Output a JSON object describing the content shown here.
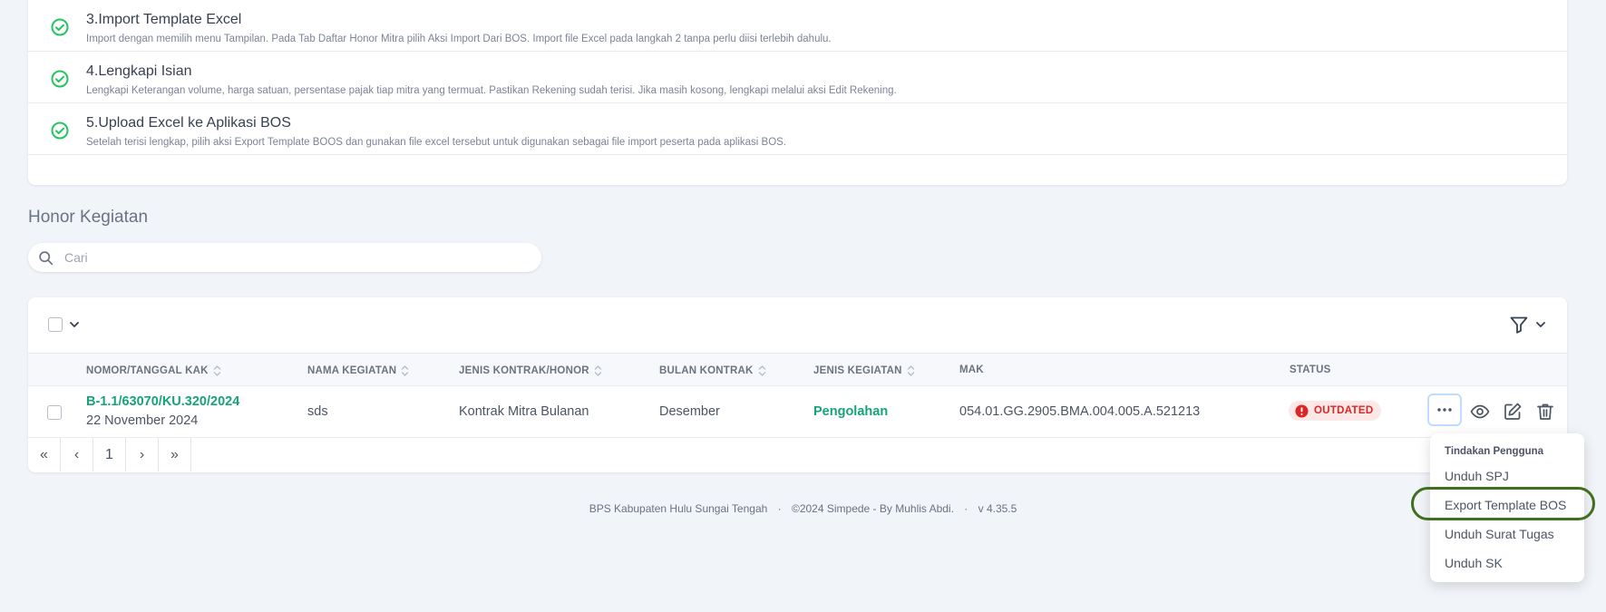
{
  "steps": [
    {
      "title": "3.Import Template Excel",
      "desc": "Import dengan memilih menu Tampilan. Pada Tab Daftar Honor Mitra pilih Aksi Import Dari BOS. Import file Excel pada langkah 2 tanpa perlu diisi terlebih dahulu."
    },
    {
      "title": "4.Lengkapi Isian",
      "desc": "Lengkapi Keterangan volume, harga satuan, persentase pajak tiap mitra yang termuat. Pastikan Rekening sudah terisi. Jika masih kosong, lengkapi melalui aksi Edit Rekening."
    },
    {
      "title": "5.Upload Excel ke Aplikasi BOS",
      "desc": "Setelah terisi lengkap, pilih aksi Export Template BOOS dan gunakan file excel tersebut untuk digunakan sebagai file import peserta pada aplikasi BOS."
    }
  ],
  "section_title": "Honor Kegiatan",
  "search": {
    "placeholder": "Cari",
    "value": ""
  },
  "table": {
    "columns": [
      "NOMOR/TANGGAL KAK",
      "NAMA KEGIATAN",
      "JENIS KONTRAK/HONOR",
      "BULAN KONTRAK",
      "JENIS KEGIATAN",
      "MAK",
      "STATUS"
    ],
    "rows": [
      {
        "nomor": "B-1.1/63070/KU.320/2024",
        "tanggal": "22 November 2024",
        "nama": "sds",
        "jenis_kontrak": "Kontrak Mitra Bulanan",
        "bulan": "Desember",
        "jenis_kegiatan": "Pengolahan",
        "mak": "054.01.GG.2905.BMA.004.005.A.521213",
        "status": "OUTDATED"
      }
    ]
  },
  "pagination": {
    "first": "«",
    "prev": "‹",
    "current": "1",
    "next": "›",
    "last": "»"
  },
  "footer": {
    "org": "BPS Kabupaten Hulu Sungai Tengah",
    "sep": "·",
    "copy": "©2024 Simpede - By Muhlis Abdi.",
    "version": "v 4.35.5"
  },
  "dropdown": {
    "header": "Tindakan Pengguna",
    "items": [
      "Unduh SPJ",
      "Export Template BOS",
      "Unduh Surat Tugas",
      "Unduh SK"
    ]
  },
  "colors": {
    "accent": "#16a37a",
    "status_outdated": "#dc2626",
    "highlight": "#3f6f1f"
  }
}
